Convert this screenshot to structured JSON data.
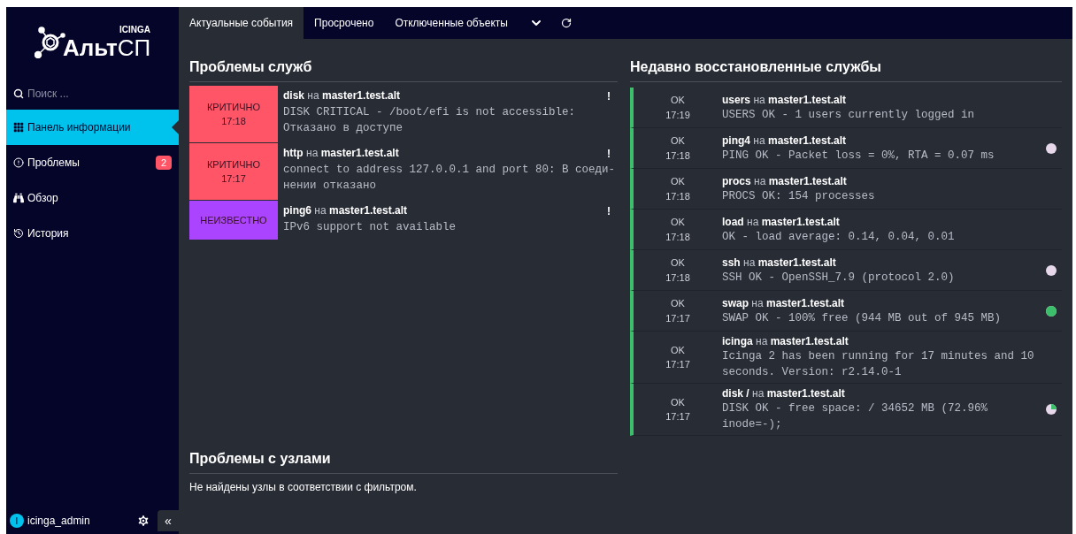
{
  "logo": {
    "brand": "ICINGA",
    "product_main": "Альт",
    "product_suffix": "СП"
  },
  "search": {
    "placeholder": "Поиск ..."
  },
  "sidebar": {
    "items": [
      {
        "label": "Панель информации",
        "kind": "grid",
        "selected": true
      },
      {
        "label": "Проблемы",
        "kind": "alert",
        "selected": false,
        "badge": "2"
      },
      {
        "label": "Обзор",
        "kind": "binoculars",
        "selected": false
      },
      {
        "label": "История",
        "kind": "history",
        "selected": false
      }
    ]
  },
  "user": {
    "initial": "I",
    "name": "icinga_admin"
  },
  "collapse_button": "«",
  "tabs": [
    {
      "label": "Актуальные события",
      "selected": true
    },
    {
      "label": "Просрочено",
      "selected": false
    },
    {
      "label": "Отключенные объекты",
      "selected": false
    }
  ],
  "service_problems": {
    "title": "Проблемы служб",
    "rows": [
      {
        "kind": "critical",
        "state_label": "КРИТИЧНО",
        "time": "17:18",
        "service": "disk",
        "on": "на",
        "host": "master1.test.alt",
        "output": "DISK CRITICAL - /boot/efi is not accessible: Отказано в доступе",
        "flag": "!"
      },
      {
        "kind": "critical",
        "state_label": "КРИТИЧНО",
        "time": "17:17",
        "service": "http",
        "on": "на",
        "host": "master1.test.alt",
        "output": "connect to address 127.0.0.1 and port 80: В соеди-нении отказано",
        "flag": "!"
      },
      {
        "kind": "unknown",
        "state_label": "НЕИЗВЕСТНО",
        "service": "ping6",
        "on": "на",
        "host": "master1.test.alt",
        "output": "IPv6 support not available",
        "flag": "!"
      }
    ]
  },
  "host_problems": {
    "title": "Проблемы с узлами",
    "message": "Не найдены узлы в соответствии с фильтром."
  },
  "recovered": {
    "title": "Недавно восстановленные службы",
    "rows": [
      {
        "state_label": "OK",
        "time": "17:19",
        "service": "users",
        "on": "на",
        "host": "master1.test.alt",
        "output": "USERS OK - 1 users currently logged in"
      },
      {
        "state_label": "OK",
        "time": "17:18",
        "service": "ping4",
        "on": "на",
        "host": "master1.test.alt",
        "output": "PING OK - Packet loss = 0%, RTA = 0.07 ms",
        "pie": {
          "kind": "empty"
        }
      },
      {
        "state_label": "OK",
        "time": "17:18",
        "service": "procs",
        "on": "на",
        "host": "master1.test.alt",
        "output": "PROCS OK: 154 processes"
      },
      {
        "state_label": "OK",
        "time": "17:18",
        "service": "load",
        "on": "на",
        "host": "master1.test.alt",
        "output": "OK - load average: 0.14, 0.04, 0.01"
      },
      {
        "state_label": "OK",
        "time": "17:18",
        "service": "ssh",
        "on": "на",
        "host": "master1.test.alt",
        "output": "SSH OK - OpenSSH_7.9 (protocol 2.0)",
        "pie": {
          "kind": "empty"
        }
      },
      {
        "state_label": "OK",
        "time": "17:17",
        "service": "swap",
        "on": "на",
        "host": "master1.test.alt",
        "output": "SWAP OK - 100% free (944 MB out of 945 MB)",
        "pie": {
          "kind": "full"
        }
      },
      {
        "state_label": "OK",
        "time": "17:17",
        "service": "icinga",
        "on": "на",
        "host": "master1.test.alt",
        "output": "Icinga 2 has been running for 17 minutes and 10 seconds. Version: r2.14.0-1"
      },
      {
        "state_label": "OK",
        "time": "17:17",
        "service": "disk /",
        "on": "на",
        "host": "master1.test.alt",
        "output": "DISK OK - free space: / 34652 MB (72.96% inode=-);",
        "pie": {
          "kind": "partial"
        }
      }
    ]
  }
}
